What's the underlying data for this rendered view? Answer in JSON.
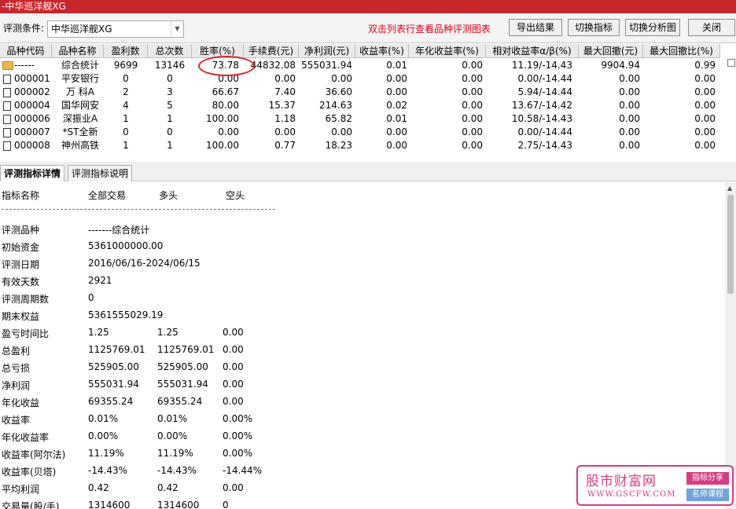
{
  "window": {
    "title": "-中华巡洋舰XG"
  },
  "toolbar": {
    "condition_label": "评测条件:",
    "condition_value": "中华巡洋舰XG",
    "hint": "双击列表行查看品种评测图表",
    "buttons": [
      "导出结果",
      "切换指标",
      "切换分析图",
      "关闭"
    ]
  },
  "grid": {
    "headers": [
      "品种代码",
      "品种名称",
      "盈利数",
      "总次数",
      "胜率(%)",
      "手续费(元)",
      "净利润(元)",
      "收益率(%)",
      "年化收益率(%)",
      "相对收益率α/β(%)",
      "最大回撤(元)",
      "最大回撤比(%)"
    ],
    "rows": [
      {
        "code": "------",
        "name": "综合统计",
        "win": "9699",
        "total": "13146",
        "rate": "73.78",
        "fee": "44832.08",
        "profit": "555031.94",
        "ret": "0.01",
        "annual": "0.00",
        "alpha": "11.19/-14.43",
        "dd": "9904.94",
        "ddr": "0.99"
      },
      {
        "code": "000001",
        "name": "平安银行",
        "win": "0",
        "total": "0",
        "rate": "0.00",
        "fee": "0.00",
        "profit": "0.00",
        "ret": "0.00",
        "annual": "0.00",
        "alpha": "0.00/-14.44",
        "dd": "0.00",
        "ddr": "0.00"
      },
      {
        "code": "000002",
        "name": "万 科A",
        "win": "2",
        "total": "3",
        "rate": "66.67",
        "fee": "7.40",
        "profit": "36.60",
        "ret": "0.00",
        "annual": "0.00",
        "alpha": "5.94/-14.44",
        "dd": "0.00",
        "ddr": "0.00"
      },
      {
        "code": "000004",
        "name": "国华网安",
        "win": "4",
        "total": "5",
        "rate": "80.00",
        "fee": "15.37",
        "profit": "214.63",
        "ret": "0.02",
        "annual": "0.00",
        "alpha": "13.67/-14.42",
        "dd": "0.00",
        "ddr": "0.00"
      },
      {
        "code": "000006",
        "name": "深振业A",
        "win": "1",
        "total": "1",
        "rate": "100.00",
        "fee": "1.18",
        "profit": "65.82",
        "ret": "0.01",
        "annual": "0.00",
        "alpha": "10.58/-14.43",
        "dd": "0.00",
        "ddr": "0.00"
      },
      {
        "code": "000007",
        "name": "*ST全新",
        "win": "0",
        "total": "0",
        "rate": "0.00",
        "fee": "0.00",
        "profit": "0.00",
        "ret": "0.00",
        "annual": "0.00",
        "alpha": "0.00/-14.44",
        "dd": "0.00",
        "ddr": "0.00"
      },
      {
        "code": "000008",
        "name": "神州高铁",
        "win": "1",
        "total": "1",
        "rate": "100.00",
        "fee": "0.77",
        "profit": "18.23",
        "ret": "0.00",
        "annual": "0.00",
        "alpha": "2.75/-14.43",
        "dd": "0.00",
        "ddr": "0.00"
      }
    ]
  },
  "tabs": [
    "评测指标详情",
    "评测指标说明"
  ],
  "detail": {
    "headers": [
      "指标名称",
      "全部交易",
      "多头",
      "空头"
    ],
    "rows": [
      {
        "label": "评测品种",
        "v": [
          "-------综合统计",
          "",
          ""
        ]
      },
      {
        "label": "初始资金",
        "v": [
          "5361000000.00",
          "",
          ""
        ]
      },
      {
        "label": "评测日期",
        "v": [
          "2016/06/16-2024/06/15",
          "",
          ""
        ]
      },
      {
        "label": "有效天数",
        "v": [
          "2921",
          "",
          ""
        ]
      },
      {
        "label": "评测周期数",
        "v": [
          "0",
          "",
          ""
        ]
      },
      {
        "label": "期末权益",
        "v": [
          "5361555029.19",
          "",
          ""
        ]
      },
      {
        "label": "盈亏时间比",
        "v": [
          "1.25",
          "1.25",
          "0.00"
        ]
      },
      {
        "label": "总盈利",
        "v": [
          "1125769.01",
          "1125769.01",
          "0.00"
        ]
      },
      {
        "label": "总亏损",
        "v": [
          "525905.00",
          "525905.00",
          "0.00"
        ]
      },
      {
        "label": "净利润",
        "v": [
          "555031.94",
          "555031.94",
          "0.00"
        ]
      },
      {
        "label": "年化收益",
        "v": [
          "69355.24",
          "69355.24",
          "0.00"
        ]
      },
      {
        "label": "收益率",
        "v": [
          "0.01%",
          "0.01%",
          "0.00%"
        ]
      },
      {
        "label": "年化收益率",
        "v": [
          "0.00%",
          "0.00%",
          "0.00%"
        ]
      },
      {
        "label": "收益率(阿尔法)",
        "v": [
          "11.19%",
          "11.19%",
          "0.00%"
        ]
      },
      {
        "label": "收益率(贝塔)",
        "v": [
          "-14.43%",
          "-14.43%",
          "-14.44%"
        ]
      },
      {
        "label": "平均利润",
        "v": [
          "0.42",
          "0.42",
          "0.00"
        ]
      },
      {
        "label": "交易量(股/手)",
        "v": [
          "1314600",
          "1314600",
          "0"
        ]
      }
    ]
  },
  "watermark": {
    "title": "股市财富网",
    "url": "WWW.GSCFW.COM",
    "tag1": "指标分享",
    "tag2": "名师课程"
  },
  "colors": {
    "titlebar": "#c8262c",
    "hint": "#e0001b",
    "highlight": "#d8262c",
    "watermark": "#d63d82"
  }
}
